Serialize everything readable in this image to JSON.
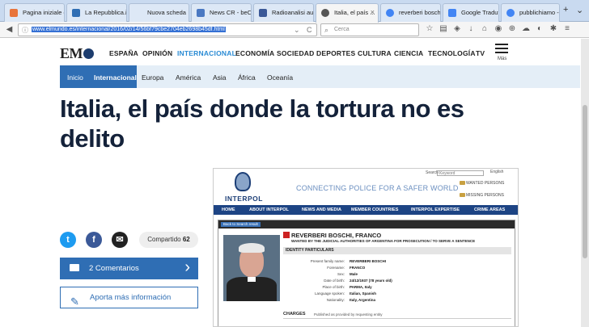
{
  "tabs": [
    {
      "label": "Pagina iniziale di ...",
      "color": "#e8743b"
    },
    {
      "label": "La Repubblica.it -...",
      "color": "#2f6eb4"
    },
    {
      "label": "Nuova scheda",
      "color": "#dde8f6"
    },
    {
      "label": "News CR - beCo...",
      "color": "#4a78c2"
    },
    {
      "label": "Radioanalisi aut...",
      "color": "#3b5998"
    },
    {
      "label": "Italia, el país ...",
      "color": "#555555"
    },
    {
      "label": "reverberi boschi ...",
      "color": "#4285f4"
    },
    {
      "label": "Google Traduttore",
      "color": "#4285f4"
    },
    {
      "label": "pubblichiamo - C...",
      "color": "#4285f4"
    }
  ],
  "browser": {
    "url": "www.elmundo.es/internacional/2016/02/14/56bf79cbe2704eb2698b45df.html",
    "search_placeholder": "Cerca",
    "new_tab": "+",
    "back": "◀",
    "reload": "C"
  },
  "site": {
    "logo": "EM",
    "sections": [
      "ESPAÑA",
      "OPINIÓN",
      "INTERNACIONAL",
      "ECONOMÍA",
      "SOCIEDAD",
      "DEPORTES",
      "CULTURA",
      "CIENCIA",
      "TECNOLOGÍA",
      "TV"
    ],
    "active_section": "INTERNACIONAL",
    "more": "Más",
    "subnav": [
      "Inicio",
      "Internacional",
      "Europa",
      "América",
      "Asia",
      "África",
      "Oceanía"
    ],
    "title": "Italia, el país donde la tortura no es delito"
  },
  "share": {
    "twitter": "t",
    "facebook": "f",
    "email": "✉",
    "shared_label": "Compartido",
    "shared_count": "62",
    "comments": "2 Comentarios",
    "contribute": "Aporta más información"
  },
  "interpol": {
    "brand": "INTERPOL",
    "slogan": "CONNECTING POLICE FOR A SAFER WORLD",
    "search_label": "Search",
    "search_placeholder": "Keyword",
    "lang": "English",
    "wanted_persons": "WANTED PERSONS",
    "missing_persons": "MISSING PERSONS",
    "menu": [
      "HOME",
      "ABOUT INTERPOL",
      "NEWS AND MEDIA",
      "MEMBER COUNTRIES",
      "INTERPOL EXPERTISE",
      "CRIME AREAS"
    ],
    "back": "Back to Search result",
    "name": "REVERBERI BOSCHI, FRANCO",
    "wanted_by": "WANTED BY THE JUDICIAL AUTHORITIES OF ARGENTINA FOR PROSECUTION / TO SERVE A SENTENCE",
    "identity": "IDENTITY PARTICULARS",
    "fields": [
      {
        "label": "Present family name:",
        "value": "REVERBERI BOSCHI"
      },
      {
        "label": "Forename:",
        "value": "FRANCO"
      },
      {
        "label": "Sex:",
        "value": "Male"
      },
      {
        "label": "Date of birth:",
        "value": "24/12/1937 (78 years old)"
      },
      {
        "label": "Place of birth:",
        "value": "PARMA, Italy"
      },
      {
        "label": "Language spoken:",
        "value": "Italian, Spanish"
      },
      {
        "label": "Nationality:",
        "value": "Italy, Argentina"
      }
    ],
    "charges": "CHARGES",
    "charges_note": "Published as provided by requesting entity"
  }
}
